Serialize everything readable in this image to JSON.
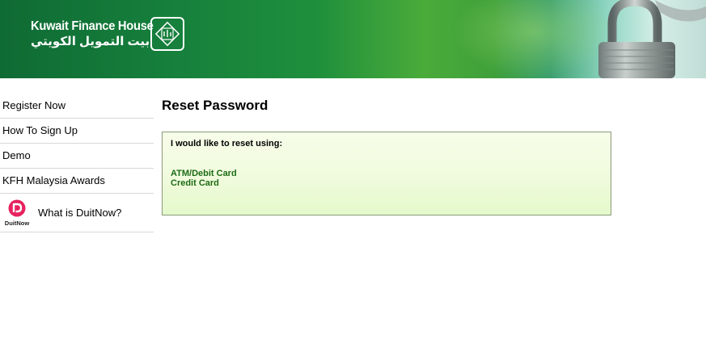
{
  "header": {
    "brand_en": "Kuwait Finance House",
    "brand_ar": "بيت التمويل الكويتي",
    "background_color": "#16803c"
  },
  "sidebar": {
    "items": [
      {
        "label": "Register Now"
      },
      {
        "label": "How To Sign Up"
      },
      {
        "label": "Demo"
      },
      {
        "label": "KFH Malaysia Awards"
      },
      {
        "label": "What is DuitNow?",
        "icon": "duitnow-logo-icon",
        "icon_text": "DuitNow"
      }
    ]
  },
  "main": {
    "title": "Reset Password",
    "panel": {
      "intro": "I would like to reset using:",
      "options": [
        {
          "label": "ATM/Debit Card"
        },
        {
          "label": "Credit Card"
        }
      ],
      "background_color": "#f0fbdd",
      "link_color": "#1d6b14"
    }
  }
}
